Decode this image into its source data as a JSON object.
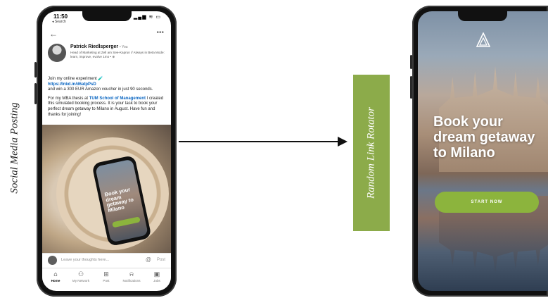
{
  "side_label": "Social Media Posting",
  "rotator_label": "Random Link Rotator",
  "linkedin": {
    "status_time": "11:50",
    "status_back": "◂ Search",
    "author_name": "Patrick Riedlsperger",
    "author_degree": "• You",
    "author_headline": "Head of Marketing at Zell am See-Kaprun // Always in Beta Mode: learn, improve, evolve",
    "post_time": "1mo • ⊕",
    "post_line1": "Join my online experiment 🧪",
    "post_link": "https://lnkd.in/d6atpPsD",
    "post_line2": "and win a 300 EUR Amazon voucher in just 90 seconds.",
    "post_para2_a": "For my MBA thesis at ",
    "post_para2_link": "TUM School of Management",
    "post_para2_b": " I created this simulated booking process. It is your task to book your perfect dream getaway to Milano in August. Have fun and thanks for joining!",
    "mini_title": "Book your dream getaway to Milano",
    "comment_placeholder": "Leave your thoughts here...",
    "comment_post": "Post",
    "tabs": [
      {
        "icon": "⌂",
        "label": "Home"
      },
      {
        "icon": "⚇",
        "label": "My Network"
      },
      {
        "icon": "⊞",
        "label": "Post"
      },
      {
        "icon": "⍾",
        "label": "Notifications"
      },
      {
        "icon": "▣",
        "label": "Jobs"
      }
    ]
  },
  "landing": {
    "title": "Book your dream getaway to Milano",
    "cta": "START NOW"
  }
}
